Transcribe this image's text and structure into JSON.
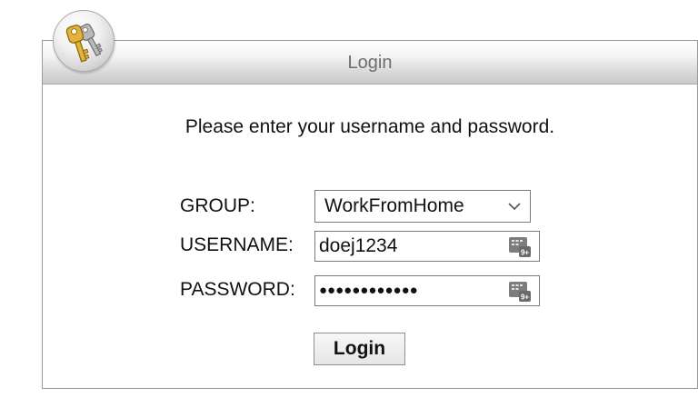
{
  "panel": {
    "title": "Login",
    "badge_icon": "keys-icon"
  },
  "intro_text": "Please enter your username and password.",
  "form": {
    "group": {
      "label": "GROUP:",
      "selected": "WorkFromHome"
    },
    "username": {
      "label": "USERNAME:",
      "value": "doej1234",
      "keyboard_icon": "virtual-keyboard-icon"
    },
    "password": {
      "label": "PASSWORD:",
      "masked_value": "●●●●●●●●●●●●",
      "keyboard_icon": "virtual-keyboard-icon"
    },
    "submit_label": "Login"
  },
  "colors": {
    "panel_border": "#9a9a9a",
    "header_text": "#6e6e6e",
    "field_border": "#7a7a7a"
  }
}
